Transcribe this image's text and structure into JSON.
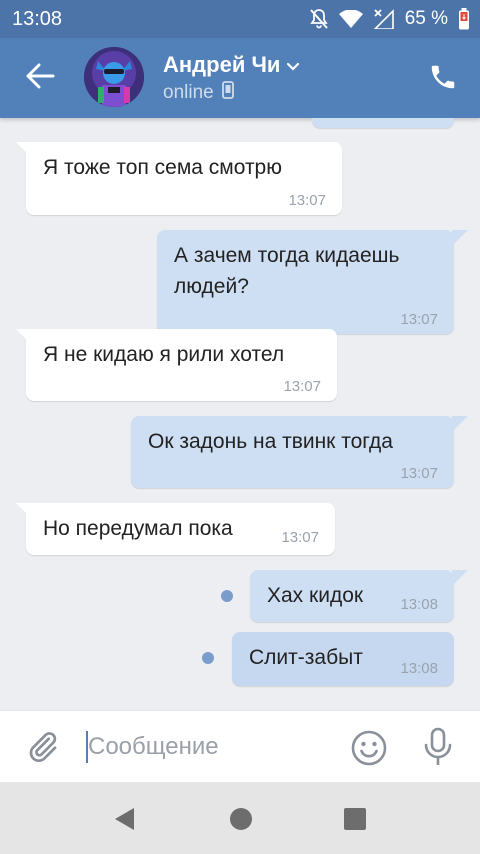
{
  "status_bar": {
    "time": "13:08",
    "battery_text": "65 %",
    "icons": [
      "mute-icon",
      "wifi-icon",
      "no-signal-icon",
      "battery-icon"
    ]
  },
  "header": {
    "contact_name": "Андрей Чи",
    "contact_status": "online",
    "icons": [
      "back-arrow-icon",
      "chevron-down-icon",
      "mobile-device-icon",
      "phone-icon"
    ],
    "colors": {
      "bar": "#5181b8",
      "status_bar": "#4d74a9"
    }
  },
  "messages": [
    {
      "direction": "in",
      "text": "Я тоже топ сема смотрю",
      "time": "13:07"
    },
    {
      "direction": "out",
      "text_lines": [
        "А зачем тогда кидаешь",
        "людей?"
      ],
      "time": "13:07"
    },
    {
      "direction": "in",
      "text": "Я не кидаю я рили хотел",
      "time": "13:07"
    },
    {
      "direction": "out",
      "text": "Ок задонь на твинк тогда",
      "time": "13:07"
    },
    {
      "direction": "in",
      "text": "Но передумал пока",
      "time": "13:07"
    },
    {
      "direction": "out",
      "text": "Хах кидок",
      "time": "13:08",
      "unread": true
    },
    {
      "direction": "out",
      "text": "Слит-забыт",
      "time": "13:08",
      "unread": true
    }
  ],
  "composer": {
    "placeholder": "Сообщение",
    "icons": [
      "paperclip-icon",
      "emoji-icon",
      "microphone-icon"
    ]
  },
  "colors": {
    "incoming_bubble": "#ffffff",
    "outgoing_bubble": "#cfdff3",
    "chat_background": "#eceef2",
    "unread_dot": "#7a9dcb"
  },
  "nav_bar": {
    "icons": [
      "back-triangle-icon",
      "home-circle-icon",
      "recents-square-icon"
    ]
  }
}
